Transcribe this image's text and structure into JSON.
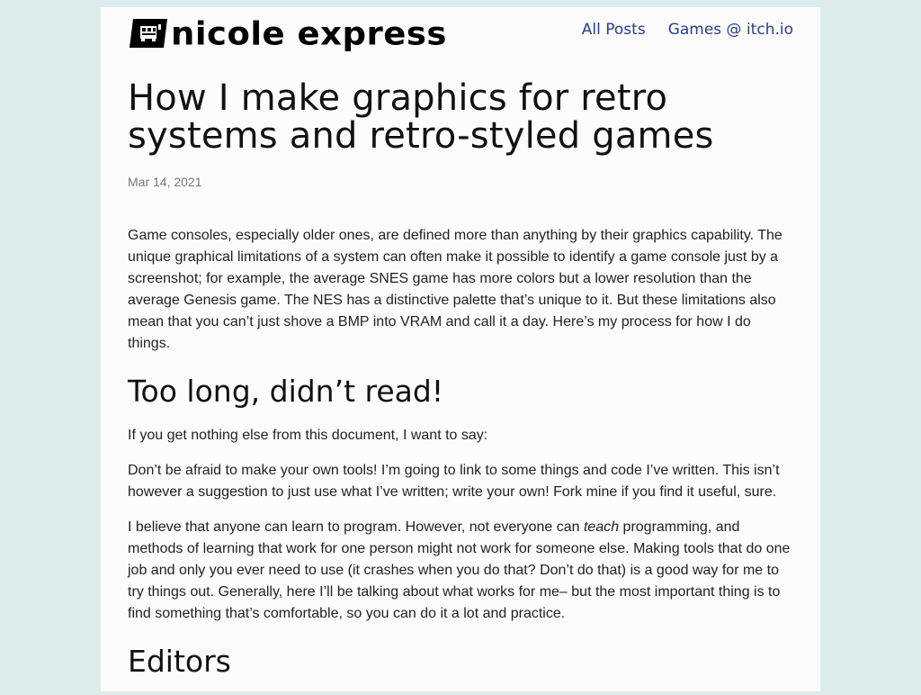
{
  "site": {
    "name": "nicole express",
    "nav": [
      "All Posts",
      "Games @ itch.io"
    ]
  },
  "article": {
    "title": "How I make graphics for retro systems and retro-styled games",
    "date": "Mar 14, 2021",
    "intro": "Game consoles, especially older ones, are defined more than anything by their graphics capability. The unique graphical limitations of a system can often make it possible to identify a game console just by a screenshot; for example, the average SNES game has more colors but a lower resolution than the average Genesis game. The NES has a distinctive palette that’s unique to it. But these limitations also mean that you can’t just shove a BMP into VRAM and call it a day. Here’s my process for how I do things.",
    "section1": {
      "heading": "Too long, didn’t read!",
      "p1": "If you get nothing else from this document, I want to say:",
      "p2": "Don’t be afraid to make your own tools! I’m going to link to some things and code I’ve written. This isn’t however a suggestion to just use what I’ve written; write your own! Fork mine if you find it useful, sure.",
      "p3_before": "I believe that anyone can learn to program. However, not everyone can ",
      "p3_emph": "teach",
      "p3_after": " programming, and methods of learning that work for one person might not work for someone else. Making tools that do one job and only you ever need to use (it crashes when you do that? Don’t do that) is a good way for me to try things out. Generally, here I’ll be talking about what works for me– but the most important thing is to find something that’s comfortable, so you can do it a lot and practice."
    },
    "section2": {
      "heading": "Editors"
    }
  },
  "colors": {
    "background": "#dcecec",
    "page": "#fcfcfc",
    "link": "#2a3f7e"
  }
}
